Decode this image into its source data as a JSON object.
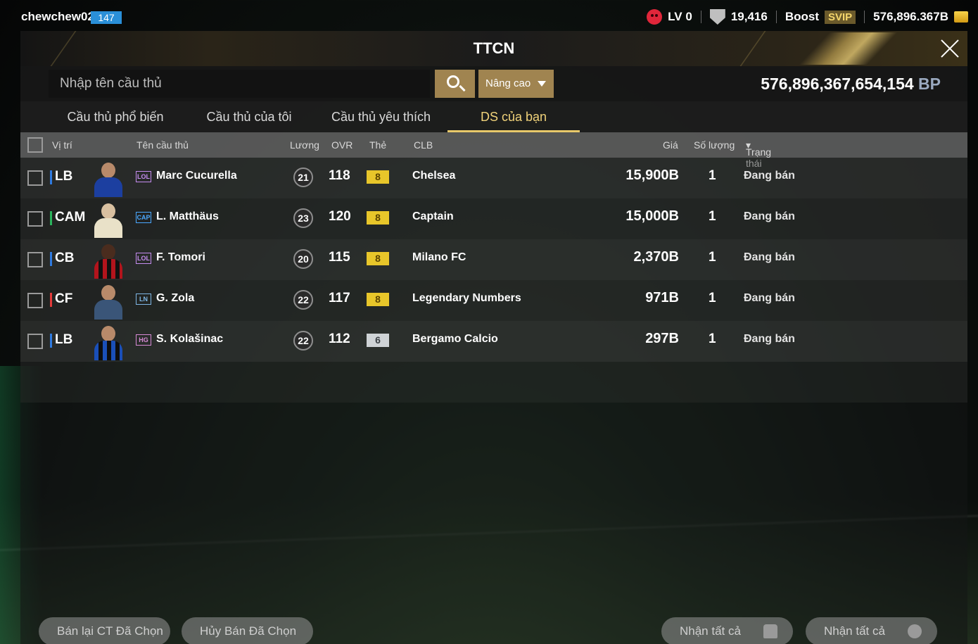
{
  "status": {
    "username": "chewchew02",
    "user_level": "147",
    "lv": "LV 0",
    "trophy": "19,416",
    "boost": "Boost",
    "svip": "SVIP",
    "coins": "576,896.367B"
  },
  "panel": {
    "title": "TTCN",
    "search_placeholder": "Nhập tên cầu thủ",
    "advanced_label": "Nâng cao",
    "balance": "576,896,367,654,154",
    "balance_unit": "BP"
  },
  "tabs": [
    {
      "label": "Cầu thủ phổ biến"
    },
    {
      "label": "Cầu thủ của tôi"
    },
    {
      "label": "Cầu thủ yêu thích"
    },
    {
      "label": "DS của bạn"
    }
  ],
  "columns": {
    "position": "Vị trí",
    "name": "Tên cầu thủ",
    "salary": "Lương",
    "ovr": "OVR",
    "card": "Thẻ",
    "club": "CLB",
    "price": "Giá",
    "quantity": "Số lượng",
    "status": "Trạng thái"
  },
  "rows": [
    {
      "position": "LB",
      "season": "LOL",
      "name": "Marc Cucurella",
      "salary": "21",
      "ovr": "118",
      "upgrade": "8",
      "club": "Chelsea",
      "price": "15,900B",
      "quantity": "1",
      "status": "Đang bán"
    },
    {
      "position": "CAM",
      "season": "CAP",
      "name": "L. Matthäus",
      "salary": "23",
      "ovr": "120",
      "upgrade": "8",
      "club": "Captain",
      "price": "15,000B",
      "quantity": "1",
      "status": "Đang bán"
    },
    {
      "position": "CB",
      "season": "LOL",
      "name": "F. Tomori",
      "salary": "20",
      "ovr": "115",
      "upgrade": "8",
      "club": "Milano FC",
      "price": "2,370B",
      "quantity": "1",
      "status": "Đang bán"
    },
    {
      "position": "CF",
      "season": "LN",
      "name": "G. Zola",
      "salary": "22",
      "ovr": "117",
      "upgrade": "8",
      "club": "Legendary Numbers",
      "price": "971B",
      "quantity": "1",
      "status": "Đang bán"
    },
    {
      "position": "LB",
      "season": "HG",
      "name": "S. Kolašinac",
      "salary": "22",
      "ovr": "112",
      "upgrade": "6",
      "club": "Bergamo Calcio",
      "price": "297B",
      "quantity": "1",
      "status": "Đang bán"
    }
  ],
  "footer": {
    "resell_selected": "Bán lại CT Đã Chọn",
    "cancel_selected": "Hủy Bán Đã Chọn",
    "collect_all_players": "Nhận tất cả",
    "collect_all_coins": "Nhận tất cả"
  },
  "colors": {
    "accent_gold": "#a08450",
    "active_tab": "#f0d27a",
    "defender": "#2f7ae0",
    "midfielder": "#2bb35c",
    "attacker": "#e33a3a"
  }
}
